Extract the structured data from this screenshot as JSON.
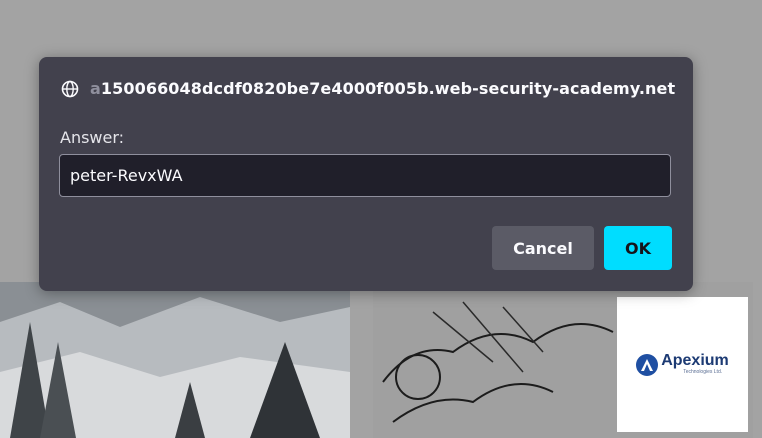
{
  "prompt": {
    "origin_prefix": "a",
    "origin_main": "150066048dcdf0820be7e4000f005b.web-security-academy.net",
    "label": "Answer:",
    "input_value": "peter-RevxWA",
    "cancel_label": "Cancel",
    "ok_label": "OK"
  },
  "background": {
    "logo_text": "Apexium",
    "logo_subtext": "Technologies Ltd."
  },
  "colors": {
    "dialog_bg": "#42414d",
    "input_bg": "#201f2a",
    "ok_button": "#00ddff",
    "cancel_button": "#5b5b66"
  },
  "icons": {
    "origin": "globe-icon"
  }
}
